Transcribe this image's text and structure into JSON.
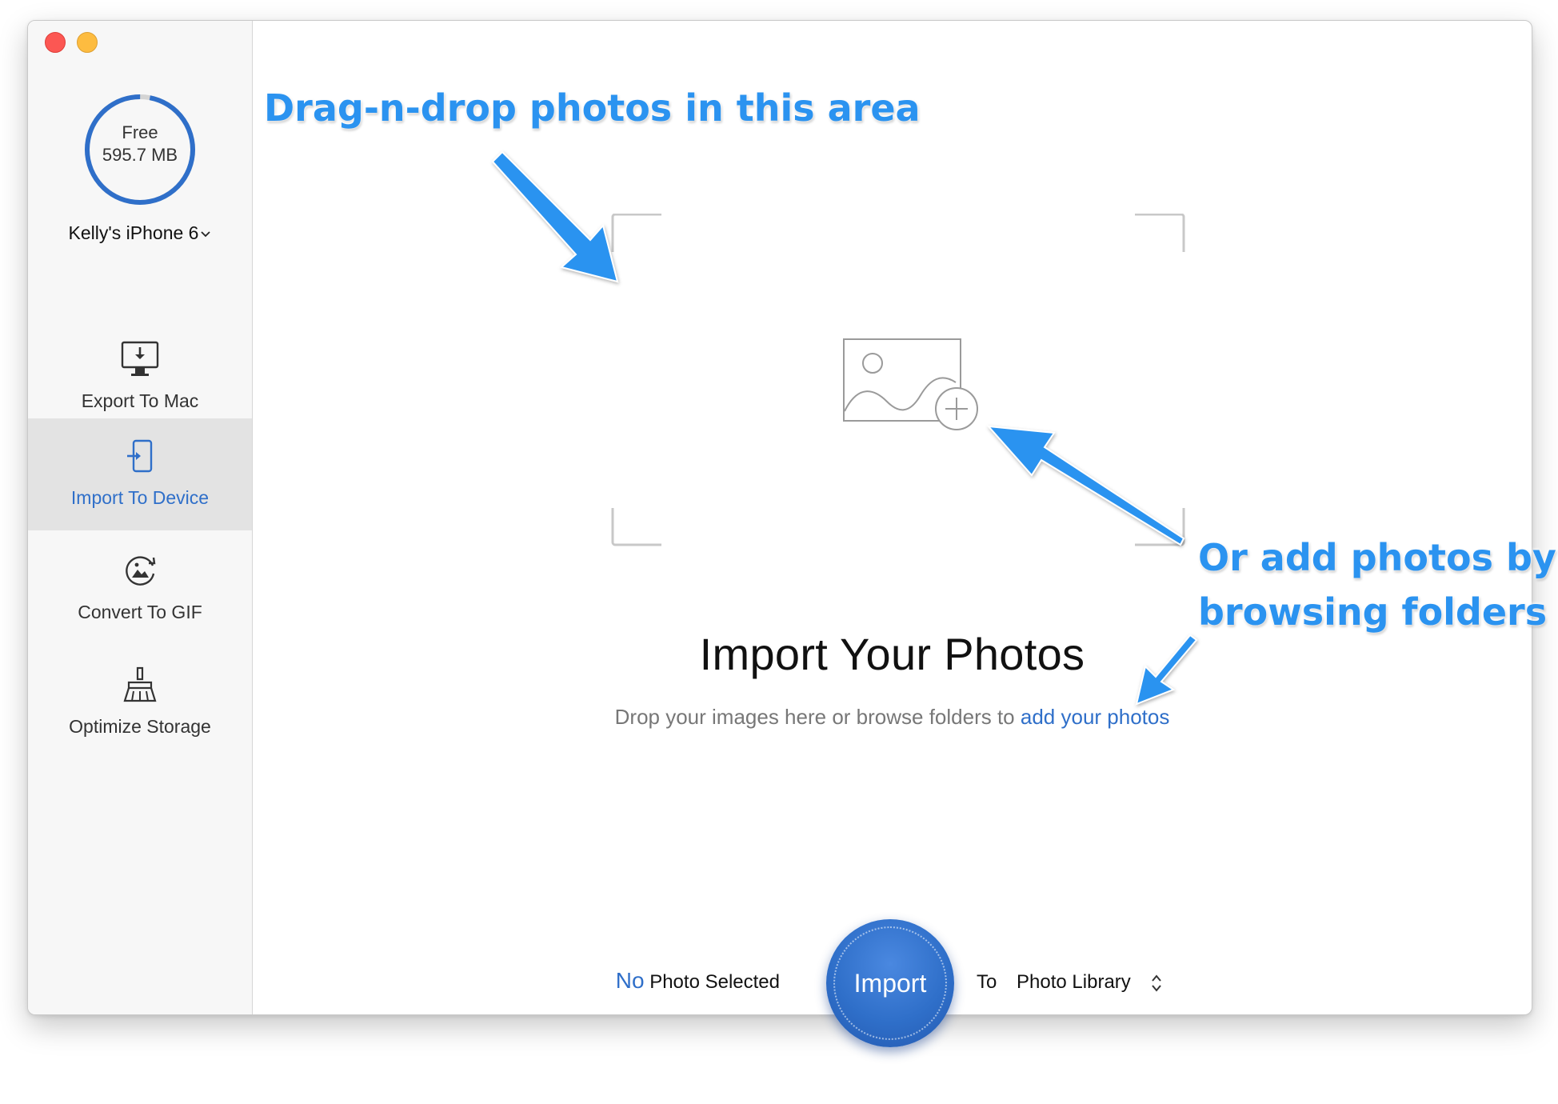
{
  "sidebar": {
    "storage": {
      "label": "Free",
      "value": "595.7 MB",
      "used_fraction": 0.03
    },
    "device_name": "Kelly's iPhone 6",
    "nav": [
      {
        "label": "Export To Mac",
        "icon": "monitor-download-icon",
        "active": false
      },
      {
        "label": "Import To Device",
        "icon": "phone-import-icon",
        "active": true
      },
      {
        "label": "Convert To GIF",
        "icon": "gif-convert-icon",
        "active": false
      },
      {
        "label": "Optimize Storage",
        "icon": "broom-icon",
        "active": false
      }
    ]
  },
  "main": {
    "title": "Import Your Photos",
    "subtitle_prefix": "Drop your images here or browse folders to",
    "subtitle_link": "add your photos",
    "drop_icon": "add-photo-icon"
  },
  "bottom": {
    "selected_count": "No",
    "selected_suffix": "Photo Selected",
    "import_label": "Import",
    "to_label": "To",
    "destination": "Photo Library"
  },
  "annotations": {
    "drag_drop": "Drag-n-drop photos in this area",
    "browse_line1": "Or add photos by",
    "browse_line2": "browsing folders"
  },
  "colors": {
    "accent": "#2f6fc9",
    "annotation": "#2b93f0",
    "close": "#fc5753",
    "minimize": "#fdbc40"
  }
}
